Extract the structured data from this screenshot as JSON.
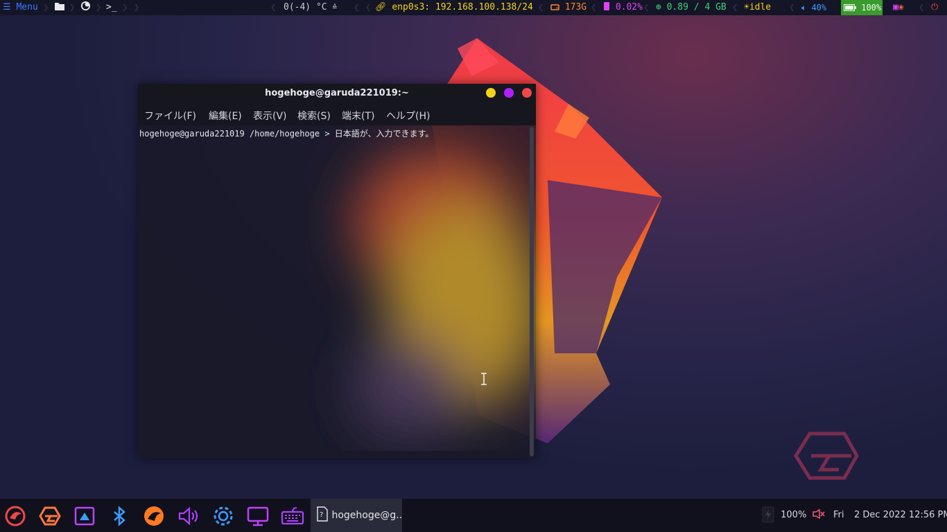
{
  "topbar": {
    "menu_label": "Menu",
    "prompt_glyph": ">_",
    "temperature": "0(-4) °C",
    "network": "enp0s3: 192.168.100.138/24",
    "disk": "173G",
    "cpu": "0.02%",
    "memory": "0.89 / 4 GB",
    "idle": "idle",
    "volume": "40%",
    "battery": "100%"
  },
  "terminal": {
    "title": "hogehoge@garuda221019:~",
    "menu": [
      "ファイル(F)",
      "編集(E)",
      "表示(V)",
      "検索(S)",
      "端末(T)",
      "ヘルプ(H)"
    ],
    "prompt": "hogehoge@garuda221019 /home/hogehoge",
    "prompt_arrow": ">",
    "input": "日本語が、入力できます。"
  },
  "taskbar": {
    "task_label": "hogehoge@g..",
    "brightness": "100%",
    "day": "Fri",
    "datetime": "2 Dec 2022 12:56 PM"
  },
  "colors": {
    "accent_blue": "#3d7bff",
    "yellow": "#f5d21a",
    "orange": "#ff8a30",
    "magenta": "#e040fb",
    "green": "#3ad17a",
    "red": "#f04848"
  }
}
